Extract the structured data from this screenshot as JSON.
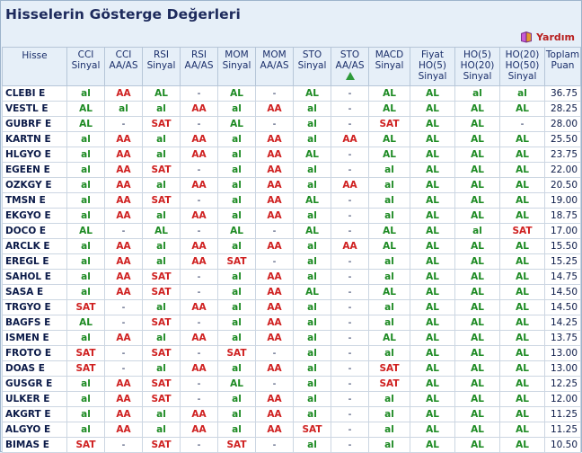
{
  "page_title": "Hisselerin Gösterge Değerleri",
  "help_label": "Yardım",
  "headers": [
    {
      "lines": [
        "Hisse"
      ]
    },
    {
      "lines": [
        "CCI",
        "Sinyal"
      ]
    },
    {
      "lines": [
        "CCI",
        "AA/AS"
      ]
    },
    {
      "lines": [
        "RSI",
        "Sinyal"
      ]
    },
    {
      "lines": [
        "RSI",
        "AA/AS"
      ]
    },
    {
      "lines": [
        "MOM",
        "Sinyal"
      ]
    },
    {
      "lines": [
        "MOM",
        "AA/AS"
      ]
    },
    {
      "lines": [
        "STO",
        "Sinyal"
      ]
    },
    {
      "lines": [
        "STO",
        "AA/AS"
      ],
      "triangle": true
    },
    {
      "lines": [
        "MACD",
        "Sinyal"
      ]
    },
    {
      "lines": [
        "Fiyat",
        "HO(5)",
        "Sinyal"
      ]
    },
    {
      "lines": [
        "HO(5)",
        "HO(20)",
        "Sinyal"
      ]
    },
    {
      "lines": [
        "HO(20)",
        "HO(50)",
        "Sinyal"
      ]
    },
    {
      "lines": [
        "Toplam",
        "Puan"
      ]
    }
  ],
  "rows": [
    {
      "name": "CLEBI E",
      "cells": [
        "al",
        "AA",
        "AL",
        "-",
        "AL",
        "-",
        "AL",
        "-",
        "AL",
        "AL",
        "al",
        "al"
      ],
      "puan": "36.75"
    },
    {
      "name": "VESTL E",
      "cells": [
        "AL",
        "al",
        "al",
        "AA",
        "al",
        "AA",
        "al",
        "-",
        "AL",
        "AL",
        "AL",
        "AL"
      ],
      "puan": "28.25"
    },
    {
      "name": "GUBRF E",
      "cells": [
        "AL",
        "-",
        "SAT",
        "-",
        "AL",
        "-",
        "al",
        "-",
        "SAT",
        "AL",
        "AL",
        "-"
      ],
      "puan": "28.00"
    },
    {
      "name": "KARTN E",
      "cells": [
        "al",
        "AA",
        "al",
        "AA",
        "al",
        "AA",
        "al",
        "AA",
        "AL",
        "AL",
        "AL",
        "AL"
      ],
      "puan": "25.50"
    },
    {
      "name": "HLGYO E",
      "cells": [
        "al",
        "AA",
        "al",
        "AA",
        "al",
        "AA",
        "AL",
        "-",
        "AL",
        "AL",
        "AL",
        "AL"
      ],
      "puan": "23.75"
    },
    {
      "name": "EGEEN E",
      "cells": [
        "al",
        "AA",
        "SAT",
        "-",
        "al",
        "AA",
        "al",
        "-",
        "al",
        "AL",
        "AL",
        "AL"
      ],
      "puan": "22.00"
    },
    {
      "name": "OZKGY E",
      "cells": [
        "al",
        "AA",
        "al",
        "AA",
        "al",
        "AA",
        "al",
        "AA",
        "al",
        "AL",
        "AL",
        "AL"
      ],
      "puan": "20.50"
    },
    {
      "name": "TMSN E",
      "cells": [
        "al",
        "AA",
        "SAT",
        "-",
        "al",
        "AA",
        "AL",
        "-",
        "al",
        "AL",
        "AL",
        "AL"
      ],
      "puan": "19.00"
    },
    {
      "name": "EKGYO E",
      "cells": [
        "al",
        "AA",
        "al",
        "AA",
        "al",
        "AA",
        "al",
        "-",
        "al",
        "AL",
        "AL",
        "AL"
      ],
      "puan": "18.75"
    },
    {
      "name": "DOCO E",
      "cells": [
        "AL",
        "-",
        "AL",
        "-",
        "AL",
        "-",
        "AL",
        "-",
        "AL",
        "AL",
        "al",
        "SAT"
      ],
      "puan": "17.00"
    },
    {
      "name": "ARCLK E",
      "cells": [
        "al",
        "AA",
        "al",
        "AA",
        "al",
        "AA",
        "al",
        "AA",
        "AL",
        "AL",
        "AL",
        "AL"
      ],
      "puan": "15.50"
    },
    {
      "name": "EREGL E",
      "cells": [
        "al",
        "AA",
        "al",
        "AA",
        "SAT",
        "-",
        "al",
        "-",
        "al",
        "AL",
        "AL",
        "AL"
      ],
      "puan": "15.25"
    },
    {
      "name": "SAHOL E",
      "cells": [
        "al",
        "AA",
        "SAT",
        "-",
        "al",
        "AA",
        "al",
        "-",
        "al",
        "AL",
        "AL",
        "AL"
      ],
      "puan": "14.75"
    },
    {
      "name": "SASA E",
      "cells": [
        "al",
        "AA",
        "SAT",
        "-",
        "al",
        "AA",
        "AL",
        "-",
        "AL",
        "AL",
        "AL",
        "AL"
      ],
      "puan": "14.50"
    },
    {
      "name": "TRGYO E",
      "cells": [
        "SAT",
        "-",
        "al",
        "AA",
        "al",
        "AA",
        "al",
        "-",
        "al",
        "AL",
        "AL",
        "AL"
      ],
      "puan": "14.50"
    },
    {
      "name": "BAGFS E",
      "cells": [
        "AL",
        "-",
        "SAT",
        "-",
        "al",
        "AA",
        "al",
        "-",
        "al",
        "AL",
        "AL",
        "AL"
      ],
      "puan": "14.25"
    },
    {
      "name": "ISMEN E",
      "cells": [
        "al",
        "AA",
        "al",
        "AA",
        "al",
        "AA",
        "al",
        "-",
        "AL",
        "AL",
        "AL",
        "AL"
      ],
      "puan": "13.75"
    },
    {
      "name": "FROTO E",
      "cells": [
        "SAT",
        "-",
        "SAT",
        "-",
        "SAT",
        "-",
        "al",
        "-",
        "al",
        "AL",
        "AL",
        "AL"
      ],
      "puan": "13.00"
    },
    {
      "name": "DOAS E",
      "cells": [
        "SAT",
        "-",
        "al",
        "AA",
        "al",
        "AA",
        "al",
        "-",
        "SAT",
        "AL",
        "AL",
        "AL"
      ],
      "puan": "13.00"
    },
    {
      "name": "GUSGR E",
      "cells": [
        "al",
        "AA",
        "SAT",
        "-",
        "AL",
        "-",
        "al",
        "-",
        "SAT",
        "AL",
        "AL",
        "AL"
      ],
      "puan": "12.25"
    },
    {
      "name": "ULKER E",
      "cells": [
        "al",
        "AA",
        "SAT",
        "-",
        "al",
        "AA",
        "al",
        "-",
        "al",
        "AL",
        "AL",
        "AL"
      ],
      "puan": "12.00"
    },
    {
      "name": "AKGRT E",
      "cells": [
        "al",
        "AA",
        "al",
        "AA",
        "al",
        "AA",
        "al",
        "-",
        "al",
        "AL",
        "AL",
        "AL"
      ],
      "puan": "11.25"
    },
    {
      "name": "ALGYO E",
      "cells": [
        "al",
        "AA",
        "al",
        "AA",
        "al",
        "AA",
        "SAT",
        "-",
        "al",
        "AL",
        "AL",
        "AL"
      ],
      "puan": "11.25"
    },
    {
      "name": "BIMAS E",
      "cells": [
        "SAT",
        "-",
        "SAT",
        "-",
        "SAT",
        "-",
        "al",
        "-",
        "al",
        "AL",
        "AL",
        "AL"
      ],
      "puan": "10.50"
    }
  ]
}
